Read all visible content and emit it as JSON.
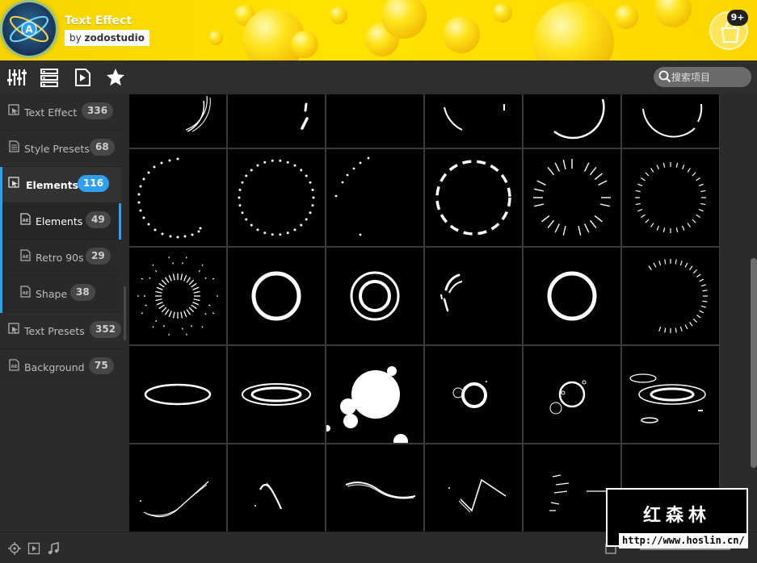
{
  "header": {
    "plugin_name": "Text Effect",
    "author_prefix": "by",
    "author_name": "zodostudio",
    "logo_letter": "A",
    "cart_badge": "9+"
  },
  "toolbar": {
    "icons": [
      "sliders-icon",
      "list-view-icon",
      "video-preview-icon",
      "favorites-star-icon"
    ],
    "search_placeholder": "搜索项目"
  },
  "sidebar": {
    "items": [
      {
        "label": "Text Effect",
        "count": "336"
      },
      {
        "label": "Style Presets",
        "count": "68"
      },
      {
        "label": "Elements",
        "count": "116"
      },
      {
        "label": "Elements",
        "count": "49"
      },
      {
        "label": "Retro 90s",
        "count": "29"
      },
      {
        "label": "Shape",
        "count": "38"
      },
      {
        "label": "Text Presets",
        "count": "352"
      },
      {
        "label": "Background",
        "count": "75"
      }
    ]
  },
  "grid": {
    "row_count_visible": 5,
    "column_count": 6
  },
  "footer": {
    "icons": [
      "target-icon",
      "play-icon",
      "music-note-icon"
    ]
  },
  "watermark": {
    "title": "红森林",
    "url": "http://www.hoslin.cn/"
  },
  "colors": {
    "accent": "#2f9ff0",
    "banner": "#ffe400",
    "sidebar_bg": "#2b2b2b"
  }
}
